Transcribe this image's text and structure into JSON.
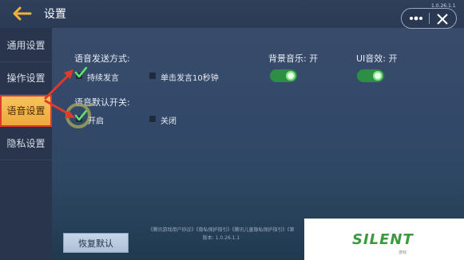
{
  "header": {
    "title": "设置",
    "version_tag": "1.0.26.1.1"
  },
  "sidebar": {
    "items": [
      {
        "label": "通用设置"
      },
      {
        "label": "操作设置"
      },
      {
        "label": "语音设置",
        "active": true
      },
      {
        "label": "隐私设置"
      }
    ]
  },
  "voice": {
    "send_mode_label": "语音发送方式:",
    "continuous_label": "持续发言",
    "continuous_checked": true,
    "single_label": "单击发言10秒钟",
    "single_checked": false,
    "default_switch_label": "语音默认开关:",
    "on_label": "开启",
    "on_checked": true,
    "off_label": "关闭",
    "off_checked": false
  },
  "audio": {
    "bgm_label": "背景音乐: 开",
    "bgm_on": true,
    "ui_label": "UI音效: 开",
    "ui_on": true
  },
  "footer": {
    "links": "《腾讯游戏用户协议》《隐私保护指引》《腾讯儿童隐私保护指引》《第",
    "version": "版本: 1.0.26.1.1"
  },
  "buttons": {
    "reset": "恢复默认"
  },
  "watermark": {
    "text": "SILENT",
    "sub": "游戏"
  },
  "colors": {
    "accent_orange": "#f0b24a",
    "toggle_green": "#2d8f45",
    "annotation_red": "#e03a2a",
    "watermark_green": "#3b9a3f"
  }
}
